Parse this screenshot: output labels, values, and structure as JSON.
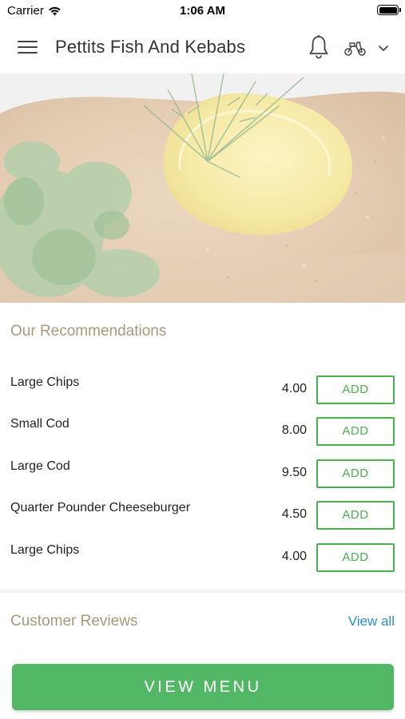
{
  "status_bar": {
    "carrier": "Carrier",
    "time": "1:06 AM"
  },
  "header": {
    "title": "Pettits Fish And Kebabs",
    "icons": [
      "menu-icon",
      "bell-icon",
      "scooter-icon",
      "chevron-down-icon"
    ]
  },
  "hero": {
    "image": "fish-with-lemon-and-dill"
  },
  "recommendations": {
    "title": "Our Recommendations",
    "items": [
      {
        "name": "Large Chips",
        "price": "4.00",
        "button": "ADD"
      },
      {
        "name": "Small Cod",
        "price": "8.00",
        "button": "ADD"
      },
      {
        "name": "Large Cod",
        "price": "9.50",
        "button": "ADD"
      },
      {
        "name": "Quarter Pounder Cheeseburger",
        "price": "4.50",
        "button": "ADD"
      },
      {
        "name": "Large Chips",
        "price": "4.00",
        "button": "ADD"
      }
    ]
  },
  "reviews": {
    "title": "Customer Reviews",
    "view_all": "View all"
  },
  "footer": {
    "view_menu": "VIEW MENU"
  },
  "colors": {
    "accent_green": "#53b866",
    "section_title": "#a8997a",
    "link_blue": "#2a8fc4"
  }
}
